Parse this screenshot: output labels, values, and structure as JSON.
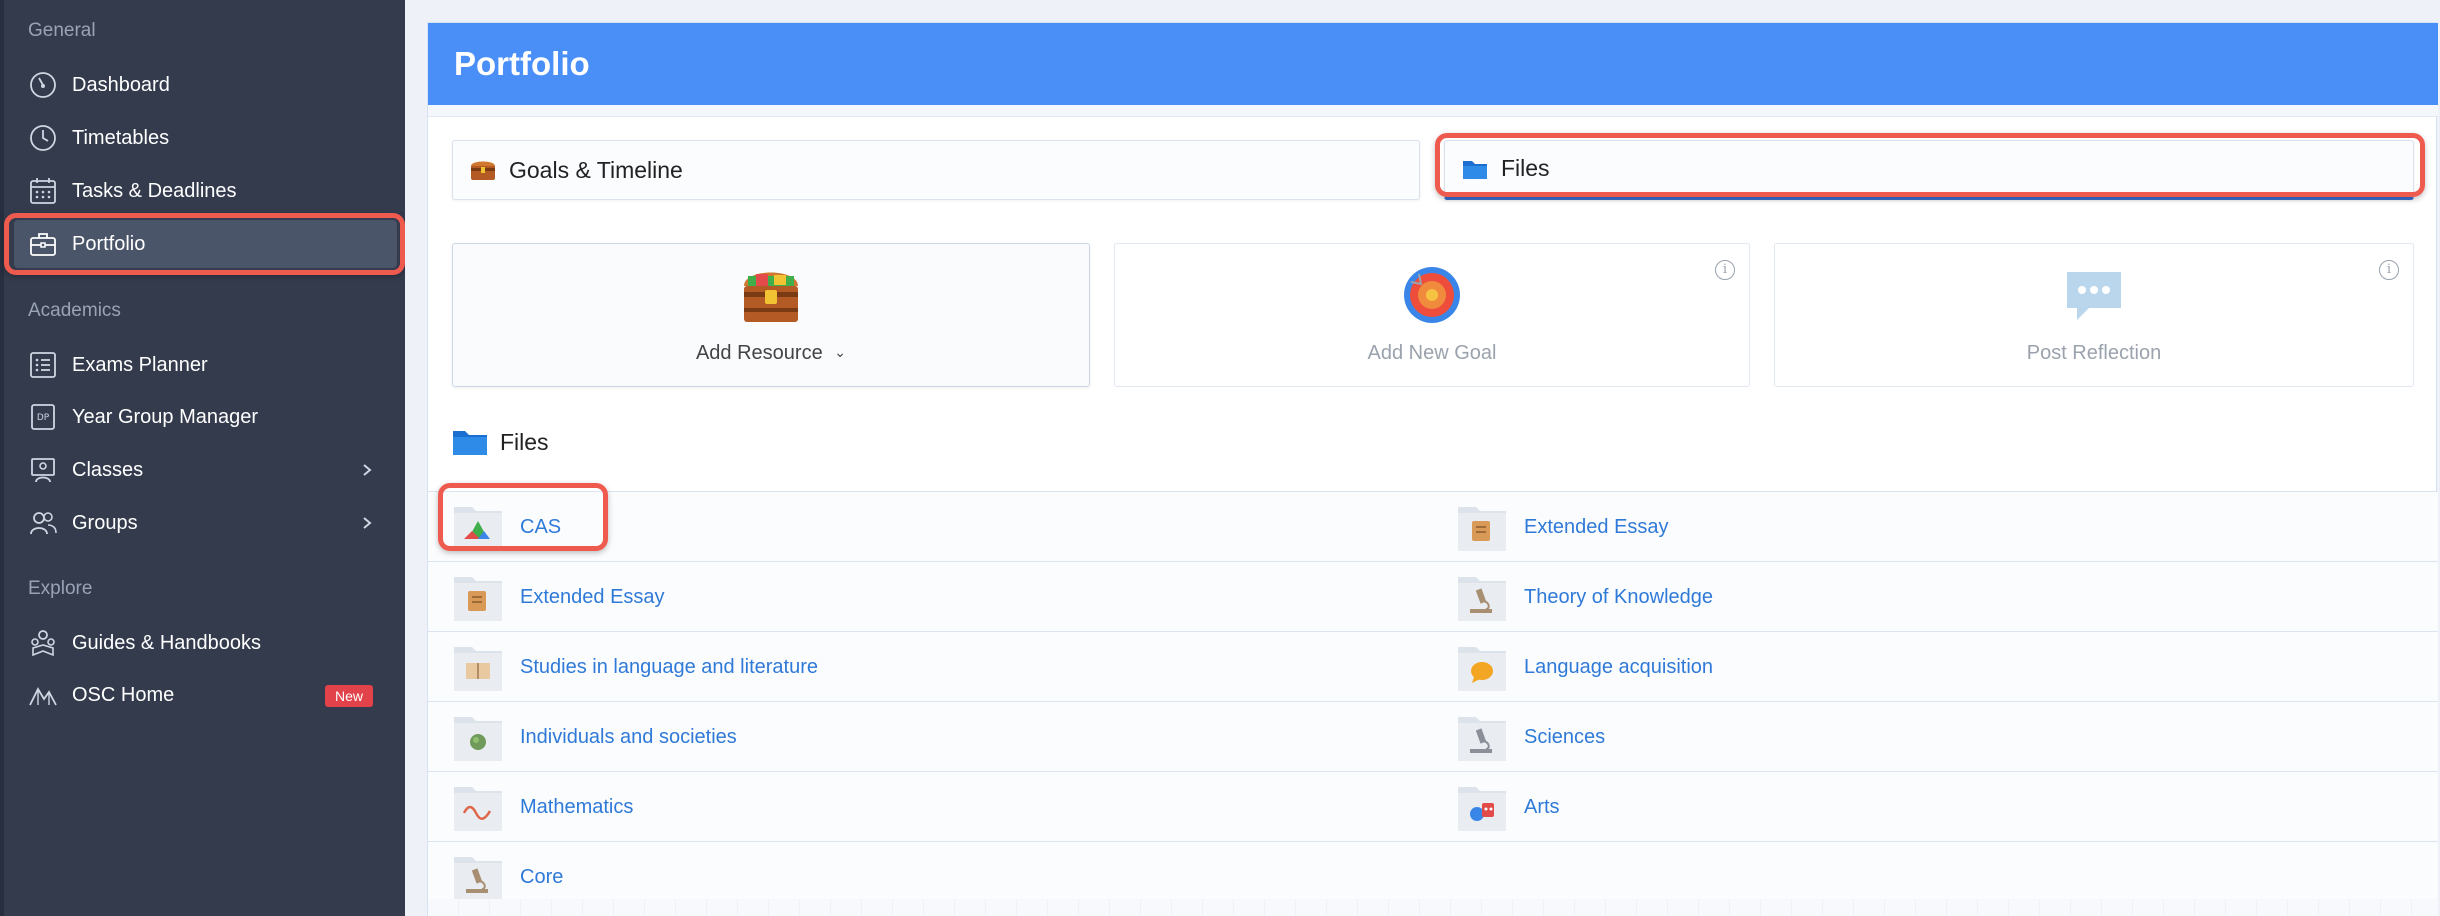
{
  "sidebar": {
    "sections": {
      "general": "General",
      "academics": "Academics",
      "explore": "Explore"
    },
    "items": {
      "dashboard": "Dashboard",
      "timetables": "Timetables",
      "tasks": "Tasks & Deadlines",
      "portfolio": "Portfolio",
      "exams": "Exams Planner",
      "yeargroup": "Year Group Manager",
      "classes": "Classes",
      "groups": "Groups",
      "guides": "Guides & Handbooks",
      "osc": "OSC Home"
    },
    "yeargroup_icon_text": "DP",
    "osc_badge": "New"
  },
  "main": {
    "title": "Portfolio",
    "tabs": {
      "goals": "Goals & Timeline",
      "files": "Files"
    },
    "cards": {
      "add_resource": "Add Resource",
      "add_goal": "Add New Goal",
      "post_reflection": "Post Reflection"
    },
    "files_heading": "Files",
    "folders": [
      [
        "CAS",
        "Extended Essay"
      ],
      [
        "Extended Essay",
        "Theory of Knowledge"
      ],
      [
        "Studies in language and literature",
        "Language acquisition"
      ],
      [
        "Individuals and societies",
        "Sciences"
      ],
      [
        "Mathematics",
        "Arts"
      ],
      [
        "Core",
        ""
      ]
    ]
  },
  "colors": {
    "sidebar_bg": "#333b4d",
    "header_blue": "#4a8ff8",
    "link_blue": "#2f7ad8",
    "highlight_red": "#ef5a4e",
    "badge_red": "#e2424a"
  }
}
